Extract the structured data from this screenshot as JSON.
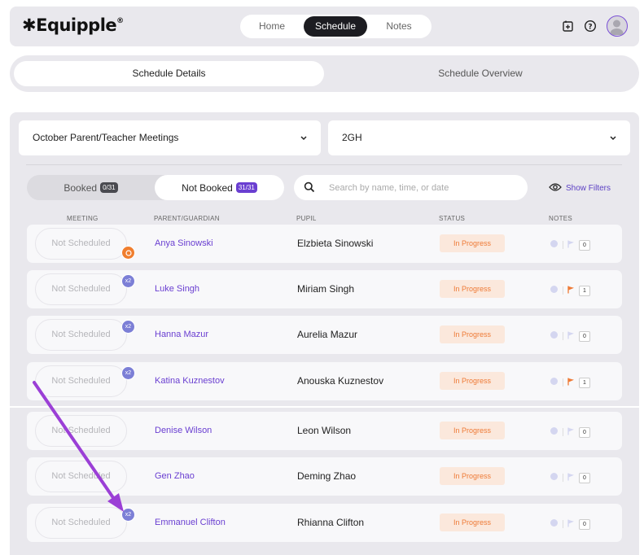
{
  "app": {
    "logo_text": "Equipple",
    "logo_mark": "®"
  },
  "nav": {
    "items": [
      {
        "label": "Home",
        "active": false
      },
      {
        "label": "Schedule",
        "active": true
      },
      {
        "label": "Notes",
        "active": false
      }
    ]
  },
  "tabs": [
    {
      "label": "Schedule Details",
      "active": true
    },
    {
      "label": "Schedule Overview",
      "active": false
    }
  ],
  "filters": {
    "event_select": "October Parent/Teacher Meetings",
    "class_select": "2GH"
  },
  "toggle": {
    "booked_label": "Booked",
    "booked_count": "0/31",
    "not_booked_label": "Not Booked",
    "not_booked_count": "31/31"
  },
  "search": {
    "placeholder": "Search by name, time, or date",
    "value": ""
  },
  "show_filters_label": "Show Filters",
  "columns": {
    "meeting": "MEETING",
    "parent": "PARENT/GUARDIAN",
    "pupil": "PUPIL",
    "status": "STATUS",
    "notes": "NOTES"
  },
  "rows": [
    {
      "meeting": "Not Scheduled",
      "badge": "chat",
      "parent": "Anya Sinowski",
      "pupil": "Elzbieta Sinowski",
      "status": "In Progress",
      "flagged": false,
      "note_count": "0"
    },
    {
      "meeting": "Not Scheduled",
      "badge": "x2",
      "parent": "Luke Singh",
      "pupil": "Miriam Singh",
      "status": "In Progress",
      "flagged": true,
      "note_count": "1"
    },
    {
      "meeting": "Not Scheduled",
      "badge": "x2",
      "parent": "Hanna Mazur",
      "pupil": "Aurelia Mazur",
      "status": "In Progress",
      "flagged": false,
      "note_count": "0"
    },
    {
      "meeting": "Not Scheduled",
      "badge": "x2",
      "parent": "Katina Kuznestov",
      "pupil": "Anouska Kuznestov",
      "status": "In Progress",
      "flagged": true,
      "note_count": "1"
    },
    {
      "meeting": "Not Scheduled",
      "badge": "",
      "parent": "Denise Wilson",
      "pupil": "Leon Wilson",
      "status": "In Progress",
      "flagged": false,
      "note_count": "0"
    },
    {
      "meeting": "Not Scheduled",
      "badge": "",
      "parent": "Gen Zhao",
      "pupil": "Deming Zhao",
      "status": "In Progress",
      "flagged": false,
      "note_count": "0"
    },
    {
      "meeting": "Not Scheduled",
      "badge": "x2",
      "parent": "Emmanuel Clifton",
      "pupil": "Rhianna Clifton",
      "status": "In Progress",
      "flagged": false,
      "note_count": "0"
    }
  ],
  "badge_x2_label": "x2",
  "colors": {
    "accent": "#6a3fd1",
    "status_text": "#ee7a36",
    "status_bg": "#fbe8dc",
    "badge_blue": "#7c7fd6",
    "chat_orange": "#f07e2e",
    "annotation_arrow": "#9b3fd6"
  },
  "icons": [
    "add-calendar-icon",
    "help-icon",
    "avatar-icon",
    "chevron-down-icon",
    "search-icon",
    "eye-icon",
    "chat-icon",
    "flag-icon"
  ]
}
